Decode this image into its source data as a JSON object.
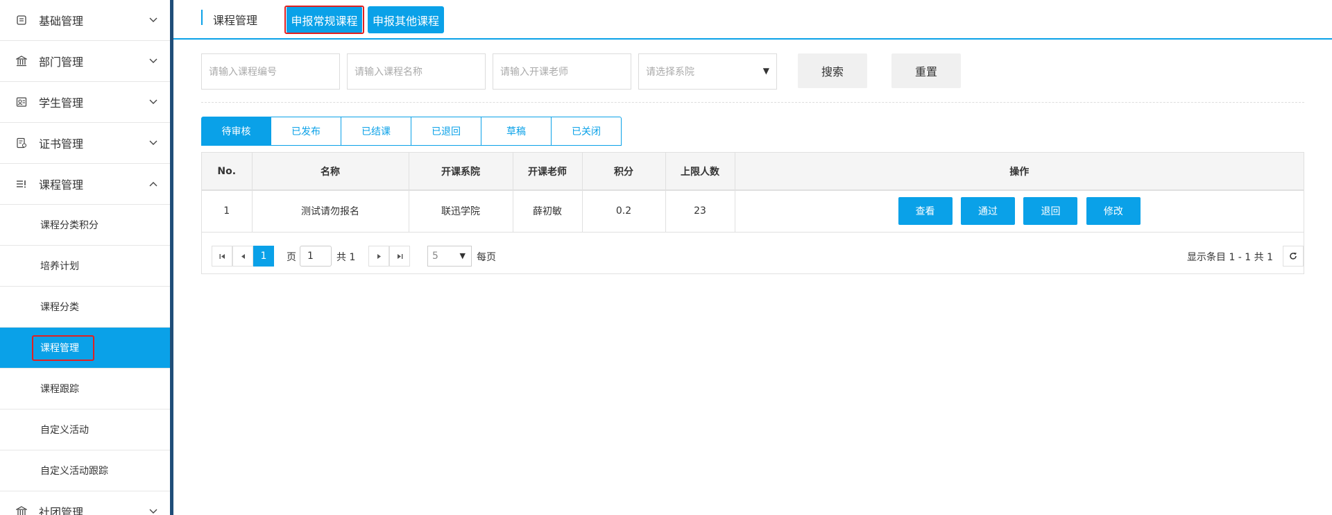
{
  "sidebar": {
    "groups": [
      {
        "label": "基础管理",
        "icon": "document-list-icon",
        "expanded": false
      },
      {
        "label": "部门管理",
        "icon": "institution-icon",
        "expanded": false
      },
      {
        "label": "学生管理",
        "icon": "student-card-icon",
        "expanded": false
      },
      {
        "label": "证书管理",
        "icon": "certificate-icon",
        "expanded": false
      },
      {
        "label": "课程管理",
        "icon": "course-list-icon",
        "expanded": true
      },
      {
        "label": "社团管理",
        "icon": "institution-icon",
        "expanded": false
      }
    ],
    "course_items": [
      {
        "label": "课程分类积分"
      },
      {
        "label": "培养计划"
      },
      {
        "label": "课程分类"
      },
      {
        "label": "课程管理",
        "active": true
      },
      {
        "label": "课程跟踪"
      },
      {
        "label": "自定义活动"
      },
      {
        "label": "自定义活动跟踪"
      }
    ]
  },
  "header": {
    "title": "课程管理",
    "btn_regular": "申报常规课程",
    "btn_other": "申报其他课程"
  },
  "filters": {
    "course_code_placeholder": "请输入课程编号",
    "course_name_placeholder": "请输入课程名称",
    "teacher_placeholder": "请输入开课老师",
    "department_select": "请选择系院",
    "search_label": "搜索",
    "reset_label": "重置"
  },
  "tabs": [
    {
      "label": "待审核",
      "active": true
    },
    {
      "label": "已发布"
    },
    {
      "label": "已结课"
    },
    {
      "label": "已退回"
    },
    {
      "label": "草稿"
    },
    {
      "label": "已关闭"
    }
  ],
  "table": {
    "columns": [
      "No.",
      "名称",
      "开课系院",
      "开课老师",
      "积分",
      "上限人数",
      "操作"
    ],
    "rows": [
      {
        "no": "1",
        "name": "测试请勿报名",
        "dept": "联迅学院",
        "teacher": "薛初敏",
        "points": "0.2",
        "limit": "23"
      }
    ],
    "actions": [
      "查看",
      "通过",
      "退回",
      "修改"
    ]
  },
  "pager": {
    "current_page": "1",
    "page_label": "页",
    "page_input": "1",
    "total_pages": "共 1",
    "page_size": "5",
    "per_page_label": "每页",
    "summary": "显示条目 1 - 1 共 1"
  },
  "colors": {
    "accent": "#0aa1e8",
    "sidebar_divider": "#1f4e79",
    "highlight_outline": "#e02020"
  }
}
